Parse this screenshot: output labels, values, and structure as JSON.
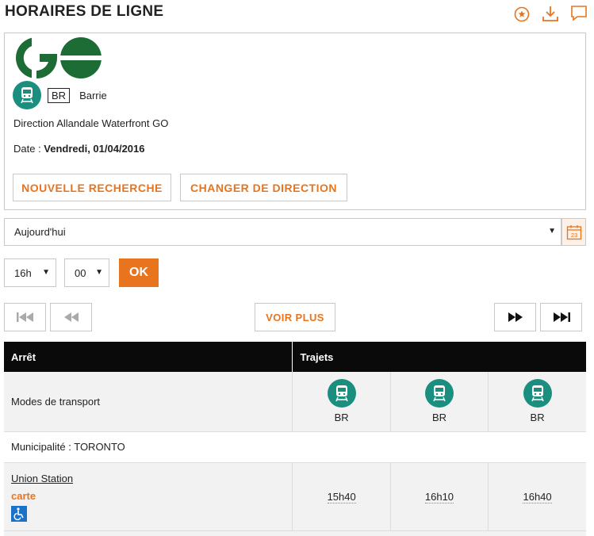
{
  "header": {
    "title": "HORAIRES DE LIGNE",
    "icons": [
      "favorite-star-icon",
      "download-icon",
      "comment-icon"
    ]
  },
  "route": {
    "logo": "GO",
    "mode_icon": "train-icon",
    "line_code": "BR",
    "line_name": "Barrie",
    "direction": "Direction Allandale Waterfront GO",
    "date_label": "Date : ",
    "date_value": "Vendredi, 01/04/2016"
  },
  "actions": {
    "new_search": "NOUVELLE RECHERCHE",
    "change_direction": "CHANGER DE DIRECTION"
  },
  "day_select": {
    "value": "Aujourd'hui",
    "calendar_day": "23"
  },
  "time_select": {
    "hour": "16h",
    "minute": "00",
    "ok_label": "OK"
  },
  "pager": {
    "voir_plus": "VOIR PLUS"
  },
  "table": {
    "headers": {
      "stop": "Arrêt",
      "trips": "Trajets"
    },
    "modes_label": "Modes de transport",
    "trip_modes": [
      "BR",
      "BR",
      "BR"
    ],
    "municipality": "Municipalité : TORONTO",
    "stop": {
      "name": "Union Station",
      "map_link": "carte",
      "times": [
        "15h40",
        "16h10",
        "16h40"
      ]
    }
  },
  "colors": {
    "accent": "#e8741e",
    "go_green": "#1a8f7f",
    "logo_green": "#1d6b35",
    "header_bg": "#0a0a0a"
  }
}
